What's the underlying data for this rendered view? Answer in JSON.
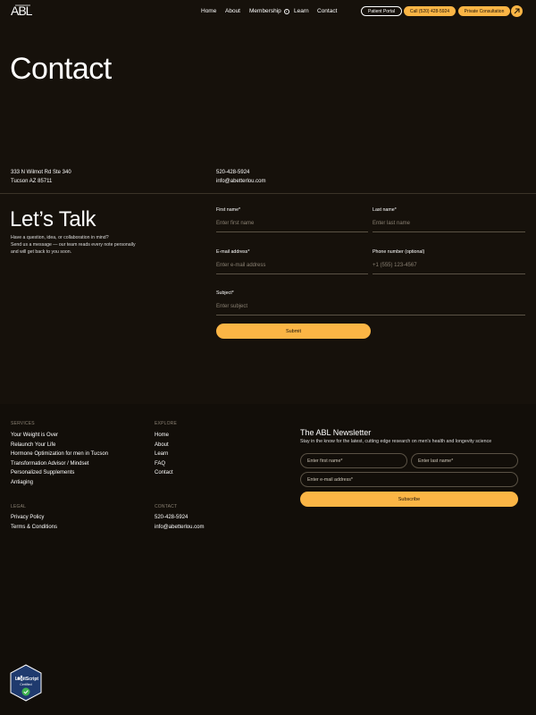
{
  "header": {
    "logo": "ABL",
    "nav": [
      {
        "label": "Home"
      },
      {
        "label": "About"
      },
      {
        "label": "Membership"
      },
      {
        "label": "Learn"
      },
      {
        "label": "Contact"
      }
    ],
    "patient_portal": "Patient Portal",
    "call": "Call (520) 428-5924",
    "consultation": "Private Consultation"
  },
  "page_title": "Contact",
  "address": {
    "line1": "333 N Wilmot Rd Ste 340",
    "line2": "Tucson AZ 85711"
  },
  "contact": {
    "phone": "520-428-5924",
    "email": "info@abetterlou.com"
  },
  "talk": {
    "title": "Let’s Talk",
    "desc_line1": "Have a question, idea, or collaboration in mind?",
    "desc_line2": "Send us a message — our team reads every note personally",
    "desc_line3": "and will get back to you soon."
  },
  "form": {
    "first_name_label": "First name*",
    "first_name_placeholder": "Enter first name",
    "last_name_label": "Last name*",
    "last_name_placeholder": "Enter last name",
    "email_label": "E-mail address*",
    "email_placeholder": "Enter e-mail address",
    "phone_label": "Phone number (optional)",
    "phone_placeholder": "+1 (555) 123-4567",
    "subject_label": "Subject*",
    "subject_placeholder": "Enter subject",
    "submit": "Submit"
  },
  "footer": {
    "services_heading": "SERVICES",
    "services": [
      "Your Weight is Over",
      "Relaunch Your Life",
      "Hormone Optimization for men in Tucson",
      "Transformation Advisor / Mindset",
      "Personalized Supplements",
      "Antiaging"
    ],
    "explore_heading": "EXPLORE",
    "explore": [
      "Home",
      "About",
      "Learn",
      "FAQ",
      "Contact"
    ],
    "legal_heading": "LEGAL",
    "legal": [
      "Privacy Policy",
      "Terms & Conditions"
    ],
    "contact_heading": "CONTACT",
    "contact": [
      "520-428-5924",
      "info@abetterlou.com"
    ]
  },
  "newsletter": {
    "title": "The ABL Newsletter",
    "subtitle": "Stay in the know for the latest, cutting edge research on men's health and longevity science",
    "first_name": "Enter first name*",
    "last_name": "Enter last name*",
    "email": "Enter e-mail address*",
    "subscribe": "Subscribe"
  },
  "badge": {
    "line1": "LegitScript",
    "line2": "Certified"
  },
  "colors": {
    "accent": "#fbb545",
    "background": "#16110b"
  }
}
